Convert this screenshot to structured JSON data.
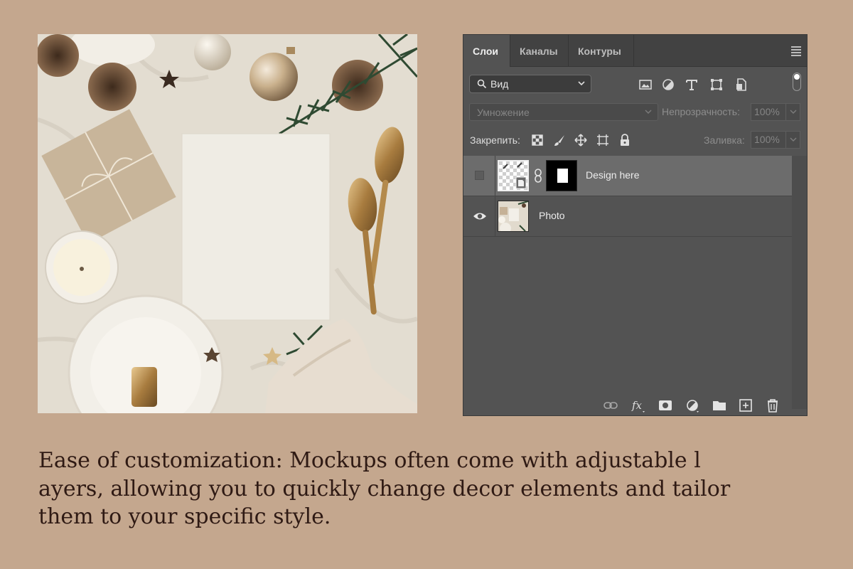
{
  "panel": {
    "tabs": [
      {
        "label": "Слои",
        "active": true
      },
      {
        "label": "Каналы",
        "active": false
      },
      {
        "label": "Контуры",
        "active": false
      }
    ],
    "filter_label": "Вид",
    "blend_mode": "Умножение",
    "opacity_label": "Непрозрачность:",
    "opacity_value": "100%",
    "lock_label": "Закрепить:",
    "fill_label": "Заливка:",
    "fill_value": "100%",
    "layers": [
      {
        "name": "Design here",
        "visible": false,
        "selected": true
      },
      {
        "name": "Photo",
        "visible": true,
        "selected": false
      }
    ]
  },
  "caption": {
    "lines": [
      "Ease of customization: Mockups often come with adjustable l",
      "ayers, allowing you to quickly change decor elements and tailor",
      "them to your specific style."
    ]
  },
  "colors": {
    "background": "#c4a78e",
    "panel": "#535353",
    "panel_dark": "#424242",
    "selected_layer": "#6c6c6c",
    "caption_text": "#2f1a14"
  }
}
